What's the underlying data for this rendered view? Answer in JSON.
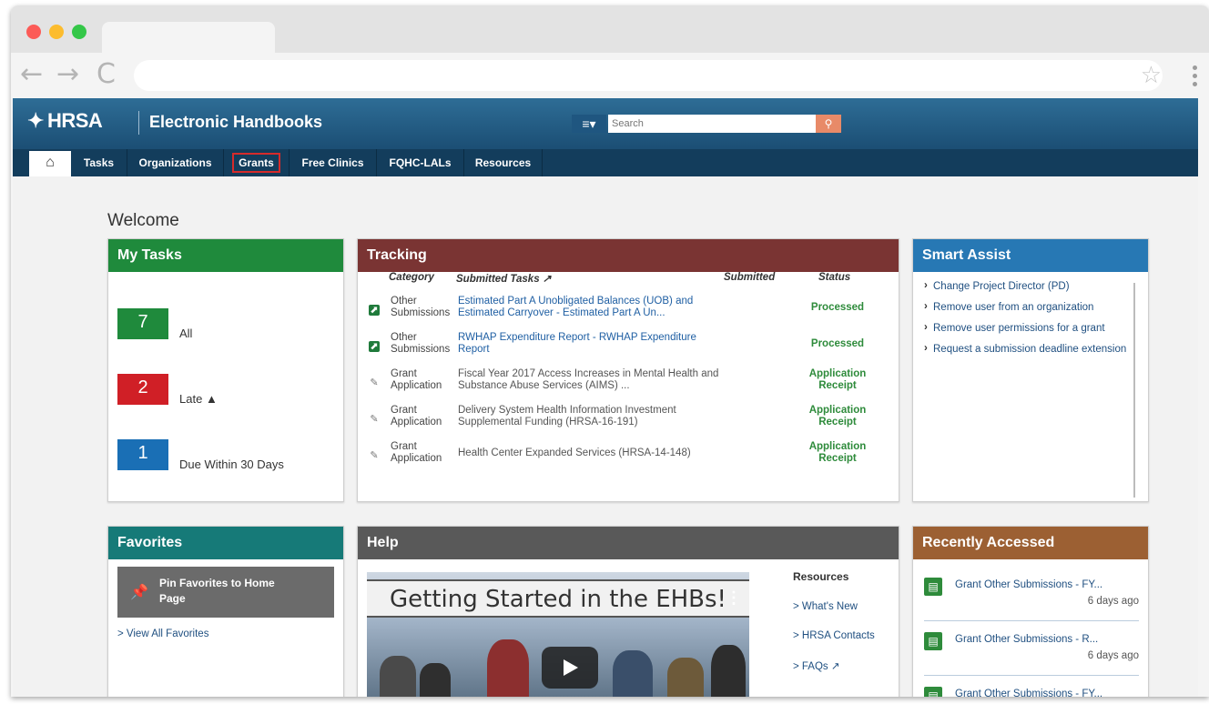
{
  "browser": {
    "back": "←",
    "forward": "→",
    "reload": "C",
    "bookmark": "☆"
  },
  "header": {
    "logo": "HRSA",
    "title": "Electronic Handbooks",
    "search_menu": "≡▾",
    "search_placeholder": "Search",
    "search_button": "🔍"
  },
  "nav": {
    "home": "🏠",
    "items": [
      "Tasks",
      "Organizations",
      "Grants",
      "Free Clinics",
      "FQHC-LALs",
      "Resources"
    ],
    "active": "Grants"
  },
  "welcome": "Welcome",
  "my_tasks": {
    "title": "My Tasks",
    "counts": [
      {
        "count": "7",
        "label": "All",
        "color": "#1f8a3c"
      },
      {
        "count": "2",
        "label": "Late",
        "color": "#d01f26",
        "warning": "▲"
      },
      {
        "count": "1",
        "label": "Due Within 30 Days",
        "color": "#1a6fb5"
      }
    ]
  },
  "tracking": {
    "title": "Tracking",
    "columns": [
      "Category",
      "Submitted Tasks",
      "Submitted",
      "Status"
    ],
    "rows": [
      {
        "icon": "processed",
        "category": "Other Submissions",
        "task": "Estimated Part A Unobligated Balances (UOB) and Estimated Carryover - Estimated Part A Un...",
        "status": "Processed"
      },
      {
        "icon": "processed",
        "category": "Other Submissions",
        "task": "RWHAP Expenditure Report - RWHAP Expenditure Report",
        "status": "Processed"
      },
      {
        "icon": "edit",
        "category": "Grant Application",
        "task": "Fiscal Year 2017 Access Increases in Mental Health and Substance Abuse Services (AIMS) ...",
        "status": "Application Receipt"
      },
      {
        "icon": "edit",
        "category": "Grant Application",
        "task": "Delivery System Health Information Investment Supplemental Funding (HRSA-16-191)",
        "status": "Application Receipt"
      },
      {
        "icon": "edit",
        "category": "Grant Application",
        "task": "Health Center Expanded Services (HRSA-14-148)",
        "status": "Application Receipt"
      }
    ]
  },
  "smart_assist": {
    "title": "Smart Assist",
    "items": [
      "Change Project Director (PD)",
      "Remove user from an organization",
      "Remove user permissions for a grant",
      "Request a submission deadline extension"
    ]
  },
  "favorites": {
    "title": "Favorites",
    "pin_label": "Pin Favorites to Home Page",
    "view_all": "> View All Favorites"
  },
  "help": {
    "title": "Help",
    "video_title": "Getting Started in the EHBs!",
    "resources_title": "Resources",
    "links": [
      "> What's New",
      "> HRSA Contacts",
      "> FAQs"
    ]
  },
  "recently_accessed": {
    "title": "Recently Accessed",
    "items": [
      {
        "title": "Grant Other Submissions - FY...",
        "when": "6 days ago"
      },
      {
        "title": "Grant Other Submissions - R...",
        "when": "6 days ago"
      },
      {
        "title": "Grant Other Submissions - FY...",
        "when": ""
      }
    ]
  },
  "colors": {
    "my_tasks": "#1f8a3c",
    "tracking": "#7a3433",
    "smart_assist": "#2778b4",
    "favorites": "#167a78",
    "help": "#595959",
    "recently_accessed": "#9c6033"
  }
}
